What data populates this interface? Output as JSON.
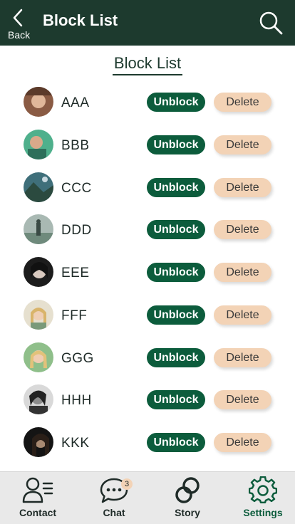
{
  "header": {
    "back_label": "Back",
    "title": "Block List",
    "background": "#1d3a2e"
  },
  "section_title": "Block List",
  "blocked_users": [
    {
      "name": "AAA",
      "avatar": "avatar-photo-1"
    },
    {
      "name": "BBB",
      "avatar": "avatar-photo-2"
    },
    {
      "name": "CCC",
      "avatar": "avatar-photo-3"
    },
    {
      "name": "DDD",
      "avatar": "avatar-photo-4"
    },
    {
      "name": "EEE",
      "avatar": "avatar-photo-5"
    },
    {
      "name": "FFF",
      "avatar": "avatar-photo-6"
    },
    {
      "name": "GGG",
      "avatar": "avatar-photo-7"
    },
    {
      "name": "HHH",
      "avatar": "avatar-photo-8"
    },
    {
      "name": "KKK",
      "avatar": "avatar-photo-9"
    }
  ],
  "actions": {
    "unblock_label": "Unblock",
    "delete_label": "Delete",
    "unblock_color": "#0c5c3c",
    "delete_color": "#f3d3b6"
  },
  "bottom_nav": {
    "items": [
      {
        "label": "Contact",
        "icon": "contact-list-icon",
        "active": false
      },
      {
        "label": "Chat",
        "icon": "chat-bubble-icon",
        "active": false,
        "badge": "3"
      },
      {
        "label": "Story",
        "icon": "story-rings-icon",
        "active": false
      },
      {
        "label": "Settings",
        "icon": "gear-icon",
        "active": true
      }
    ]
  }
}
